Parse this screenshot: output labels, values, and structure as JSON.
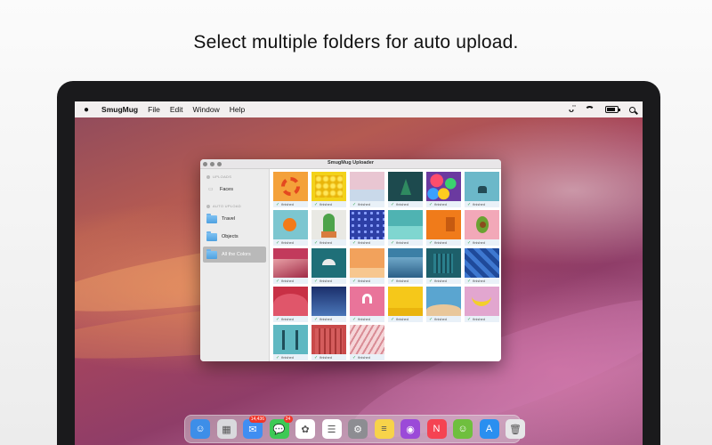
{
  "headline": "Select multiple folders for auto upload.",
  "menubar": {
    "apple_icon": "apple-logo-icon",
    "app_name": "SmugMug",
    "items": [
      "File",
      "Edit",
      "Window",
      "Help"
    ],
    "status_icons": [
      "smugmug-status-icon",
      "wifi-icon",
      "battery-icon",
      "search-icon"
    ]
  },
  "window": {
    "title": "SmugMug Uploader",
    "sidebar": {
      "uploads_header": "UPLOADS",
      "faces_label": "Faces",
      "auto_upload_header": "AUTO UPLOAD",
      "folders": [
        {
          "label": "Travel",
          "selected": false
        },
        {
          "label": "Objects",
          "selected": false
        },
        {
          "label": "All the Colors",
          "selected": true
        }
      ]
    },
    "status_text": "finished",
    "thumbnails": [
      {
        "subject": "yellow-orange-radial",
        "bg": "#f4a13a"
      },
      {
        "subject": "yellow-balls",
        "bg": "#f3d21a"
      },
      {
        "subject": "pink-pastel-sky",
        "bg": "#e9c6d2"
      },
      {
        "subject": "teal-tree",
        "bg": "#1d4a4e"
      },
      {
        "subject": "colorful-balls",
        "bg": "#6b3aa0"
      },
      {
        "subject": "blue-rock-in-sea",
        "bg": "#6cb8c9"
      },
      {
        "subject": "orange-on-teal",
        "bg": "#7cc6d0"
      },
      {
        "subject": "green-cactus",
        "bg": "#e9e9e4"
      },
      {
        "subject": "blue-spheres-pattern",
        "bg": "#2d3fa6"
      },
      {
        "subject": "teal-water",
        "bg": "#4fb3b2"
      },
      {
        "subject": "orange-wall",
        "bg": "#f07b1a"
      },
      {
        "subject": "avocado-on-pink",
        "bg": "#f2a8b8"
      },
      {
        "subject": "red-pink-landscape",
        "bg": "#c23a5c"
      },
      {
        "subject": "lamp-on-teal",
        "bg": "#1f6f78"
      },
      {
        "subject": "orange-sky",
        "bg": "#f2a25c"
      },
      {
        "subject": "blue-water",
        "bg": "#3b7fa6"
      },
      {
        "subject": "teal-building",
        "bg": "#1d5f6a"
      },
      {
        "subject": "blue-geometric",
        "bg": "#2a5aa8"
      },
      {
        "subject": "red-hills",
        "bg": "#c83045"
      },
      {
        "subject": "navy-gradient",
        "bg": "#1b2f6b"
      },
      {
        "subject": "pink-headphones",
        "bg": "#e9749a"
      },
      {
        "subject": "yellow-wall",
        "bg": "#f5c81a"
      },
      {
        "subject": "blue-sand-dunes",
        "bg": "#5aa5d0"
      },
      {
        "subject": "banana-on-pink",
        "bg": "#e2a6cf"
      },
      {
        "subject": "teal-poles",
        "bg": "#5fb8c2"
      },
      {
        "subject": "red-building",
        "bg": "#c94a4a"
      },
      {
        "subject": "pink-stripes",
        "bg": "#f0c6c9"
      }
    ]
  },
  "dock": {
    "apps": [
      {
        "name": "finder-icon",
        "color": "#3d8ee8",
        "glyph": "☺"
      },
      {
        "name": "launchpad-icon",
        "color": "#d9d9dd",
        "glyph": "▦"
      },
      {
        "name": "mail-icon",
        "color": "#3f8ef2",
        "glyph": "✉",
        "badge": "14,436"
      },
      {
        "name": "messages-icon",
        "color": "#3dc955",
        "glyph": "💬",
        "badge": "24"
      },
      {
        "name": "photos-icon",
        "color": "#ffffff",
        "glyph": "✿"
      },
      {
        "name": "reminders-icon",
        "color": "#ffffff",
        "glyph": "☰"
      },
      {
        "name": "system-preferences-icon",
        "color": "#8d8d92",
        "glyph": "⚙"
      },
      {
        "name": "notes-icon",
        "color": "#f7d34a",
        "glyph": "≡"
      },
      {
        "name": "podcasts-icon",
        "color": "#9b4ad8",
        "glyph": "◉"
      },
      {
        "name": "news-icon",
        "color": "#f54352",
        "glyph": "N"
      },
      {
        "name": "smugmug-icon",
        "color": "#6fbf3e",
        "glyph": "☺"
      },
      {
        "name": "app-store-icon",
        "color": "#2a8ff0",
        "glyph": "A"
      },
      {
        "name": "trash-icon",
        "color": "#e6e6e8",
        "glyph": "🗑"
      }
    ]
  }
}
